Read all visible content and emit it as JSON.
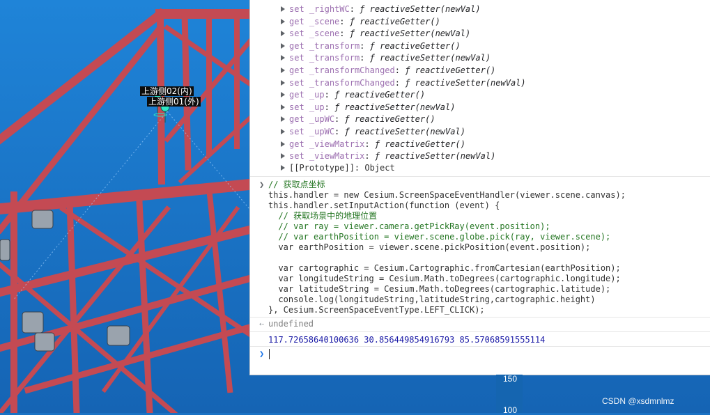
{
  "scene": {
    "labels": [
      "上游侧02(内)",
      "上游侧01(外)"
    ],
    "ruler_ticks": [
      "150",
      "100"
    ],
    "watermark": "CSDN @xsdmnlmz",
    "colors": {
      "water": "#1a72c4",
      "truss": "#c44a53",
      "marker": "#2ee6c4"
    }
  },
  "console": {
    "properties": [
      {
        "accessor": "set",
        "name": "_rightWC",
        "func": "reactiveSetter",
        "args": "newVal"
      },
      {
        "accessor": "get",
        "name": "_scene",
        "func": "reactiveGetter",
        "args": ""
      },
      {
        "accessor": "set",
        "name": "_scene",
        "func": "reactiveSetter",
        "args": "newVal"
      },
      {
        "accessor": "get",
        "name": "_transform",
        "func": "reactiveGetter",
        "args": ""
      },
      {
        "accessor": "set",
        "name": "_transform",
        "func": "reactiveSetter",
        "args": "newVal"
      },
      {
        "accessor": "get",
        "name": "_transformChanged",
        "func": "reactiveGetter",
        "args": ""
      },
      {
        "accessor": "set",
        "name": "_transformChanged",
        "func": "reactiveSetter",
        "args": "newVal"
      },
      {
        "accessor": "get",
        "name": "_up",
        "func": "reactiveGetter",
        "args": ""
      },
      {
        "accessor": "set",
        "name": "_up",
        "func": "reactiveSetter",
        "args": "newVal"
      },
      {
        "accessor": "get",
        "name": "_upWC",
        "func": "reactiveGetter",
        "args": ""
      },
      {
        "accessor": "set",
        "name": "_upWC",
        "func": "reactiveSetter",
        "args": "newVal"
      },
      {
        "accessor": "get",
        "name": "_viewMatrix",
        "func": "reactiveGetter",
        "args": ""
      },
      {
        "accessor": "set",
        "name": "_viewMatrix",
        "func": "reactiveSetter",
        "args": "newVal"
      }
    ],
    "prototype_label": "[[Prototype]]: Object",
    "code_lines": [
      "// 获取点坐标",
      "this.handler = new Cesium.ScreenSpaceEventHandler(viewer.scene.canvas);",
      "this.handler.setInputAction(function (event) {",
      "  // 获取场景中的地理位置",
      "  // var ray = viewer.camera.getPickRay(event.position);",
      "  // var earthPosition = viewer.scene.globe.pick(ray, viewer.scene);",
      "  var earthPosition = viewer.scene.pickPosition(event.position);",
      "",
      "  var cartographic = Cesium.Cartographic.fromCartesian(earthPosition);",
      "  var longitudeString = Cesium.Math.toDegrees(cartographic.longitude);",
      "  var latitudeString = Cesium.Math.toDegrees(cartographic.latitude);",
      "  console.log(longitudeString,latitudeString,cartographic.height)",
      "}, Cesium.ScreenSpaceEventType.LEFT_CLICK);"
    ],
    "return_value": "undefined",
    "log_output": "117.72658640100636 30.856449854916793 85.57068591555114",
    "input_value": ""
  }
}
